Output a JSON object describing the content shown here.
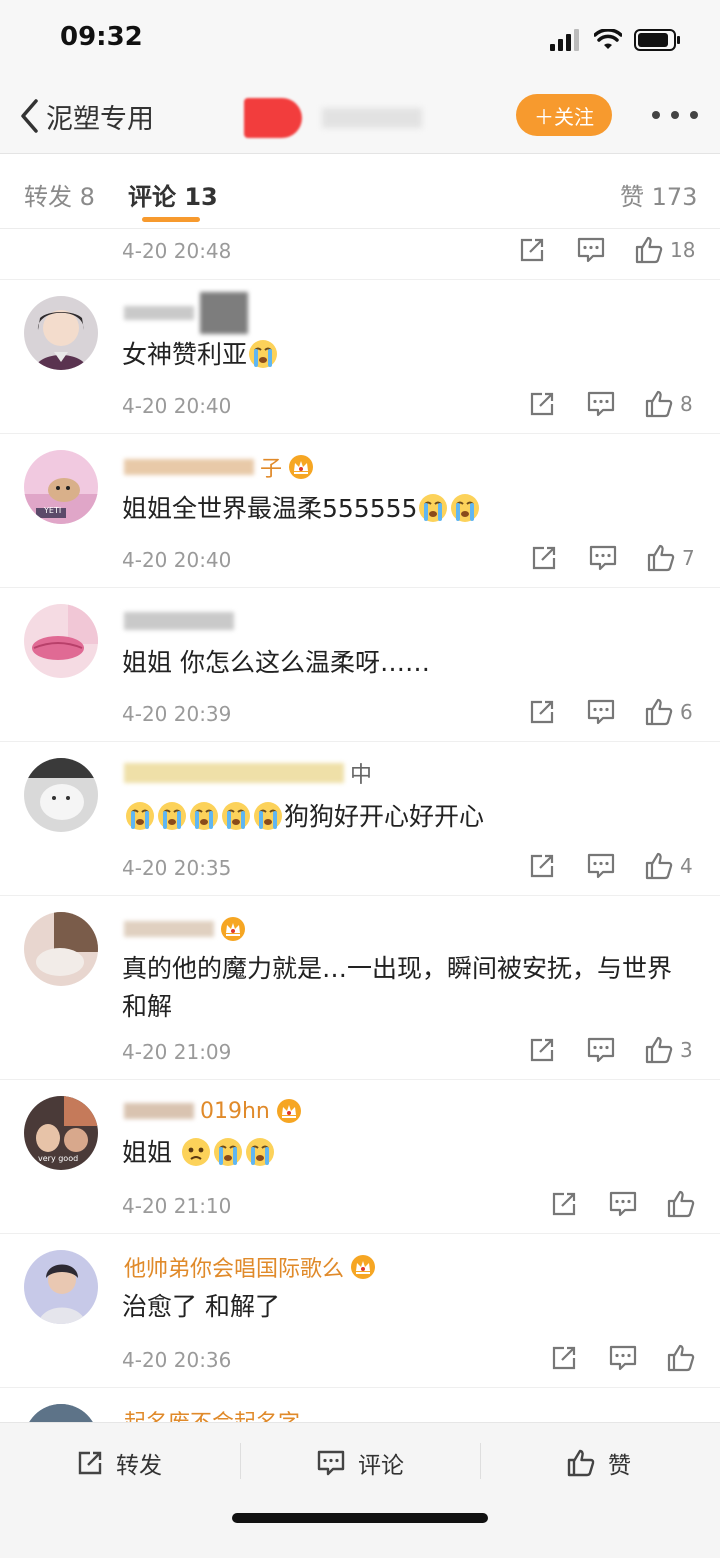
{
  "status_bar": {
    "time": "09:32",
    "icons": [
      "signal-icon",
      "wifi-icon",
      "battery-icon"
    ]
  },
  "nav": {
    "back_label": "泥塑专用",
    "follow_label": "＋关注",
    "more_icon": "more-icon"
  },
  "tabs": [
    {
      "label": "转发 8"
    },
    {
      "label": "评论 13",
      "active": true
    },
    {
      "label": "赞 173"
    }
  ],
  "colors": {
    "accent": "#f79a2e",
    "username": "#e08a2a",
    "muted": "#9a9a9a",
    "redaction_red": "#f23d3d"
  },
  "comments": [
    {
      "username": "",
      "text": "",
      "time": "4-20 20:48",
      "likes": "18",
      "vip": false
    },
    {
      "username": "",
      "text": "女神赞利亚",
      "time": "4-20 20:40",
      "likes": "8",
      "vip": false,
      "emojis": [
        "crying-emoji"
      ]
    },
    {
      "username": "子",
      "text": "姐姐全世界最温柔555555",
      "time": "4-20 20:40",
      "likes": "7",
      "vip": true,
      "emojis": [
        "crying-emoji",
        "crying-emoji"
      ]
    },
    {
      "username": "",
      "text": "姐姐 你怎么这么温柔呀……",
      "time": "4-20 20:39",
      "likes": "6",
      "vip": false
    },
    {
      "username": "中",
      "text": "狗狗好开心好开心",
      "time": "4-20 20:35",
      "likes": "4",
      "vip": false,
      "emojis": [
        "crying-emoji",
        "crying-emoji",
        "crying-emoji",
        "crying-emoji",
        "crying-emoji"
      ]
    },
    {
      "username": "",
      "text": "真的他的魔力就是…一出现，瞬间被安抚，与世界和解",
      "time": "4-20 21:09",
      "likes": "3",
      "vip": true
    },
    {
      "username": "019hn",
      "text": "姐姐",
      "time": "4-20 21:10",
      "likes": "",
      "vip": true,
      "emojis": [
        "sad-emoji",
        "crying-emoji",
        "crying-emoji"
      ]
    },
    {
      "username": "他帅弟你会唱国际歌么",
      "text": "治愈了 和解了",
      "time": "4-20 20:36",
      "likes": "",
      "vip": true
    },
    {
      "username": "起名废不会起名字",
      "text": "",
      "time": "",
      "likes": "",
      "vip": false
    }
  ],
  "avatar_captions": {
    "c3": "YETI",
    "c7": "very good"
  },
  "bottom": {
    "repost": "转发",
    "comment": "评论",
    "like": "赞"
  }
}
